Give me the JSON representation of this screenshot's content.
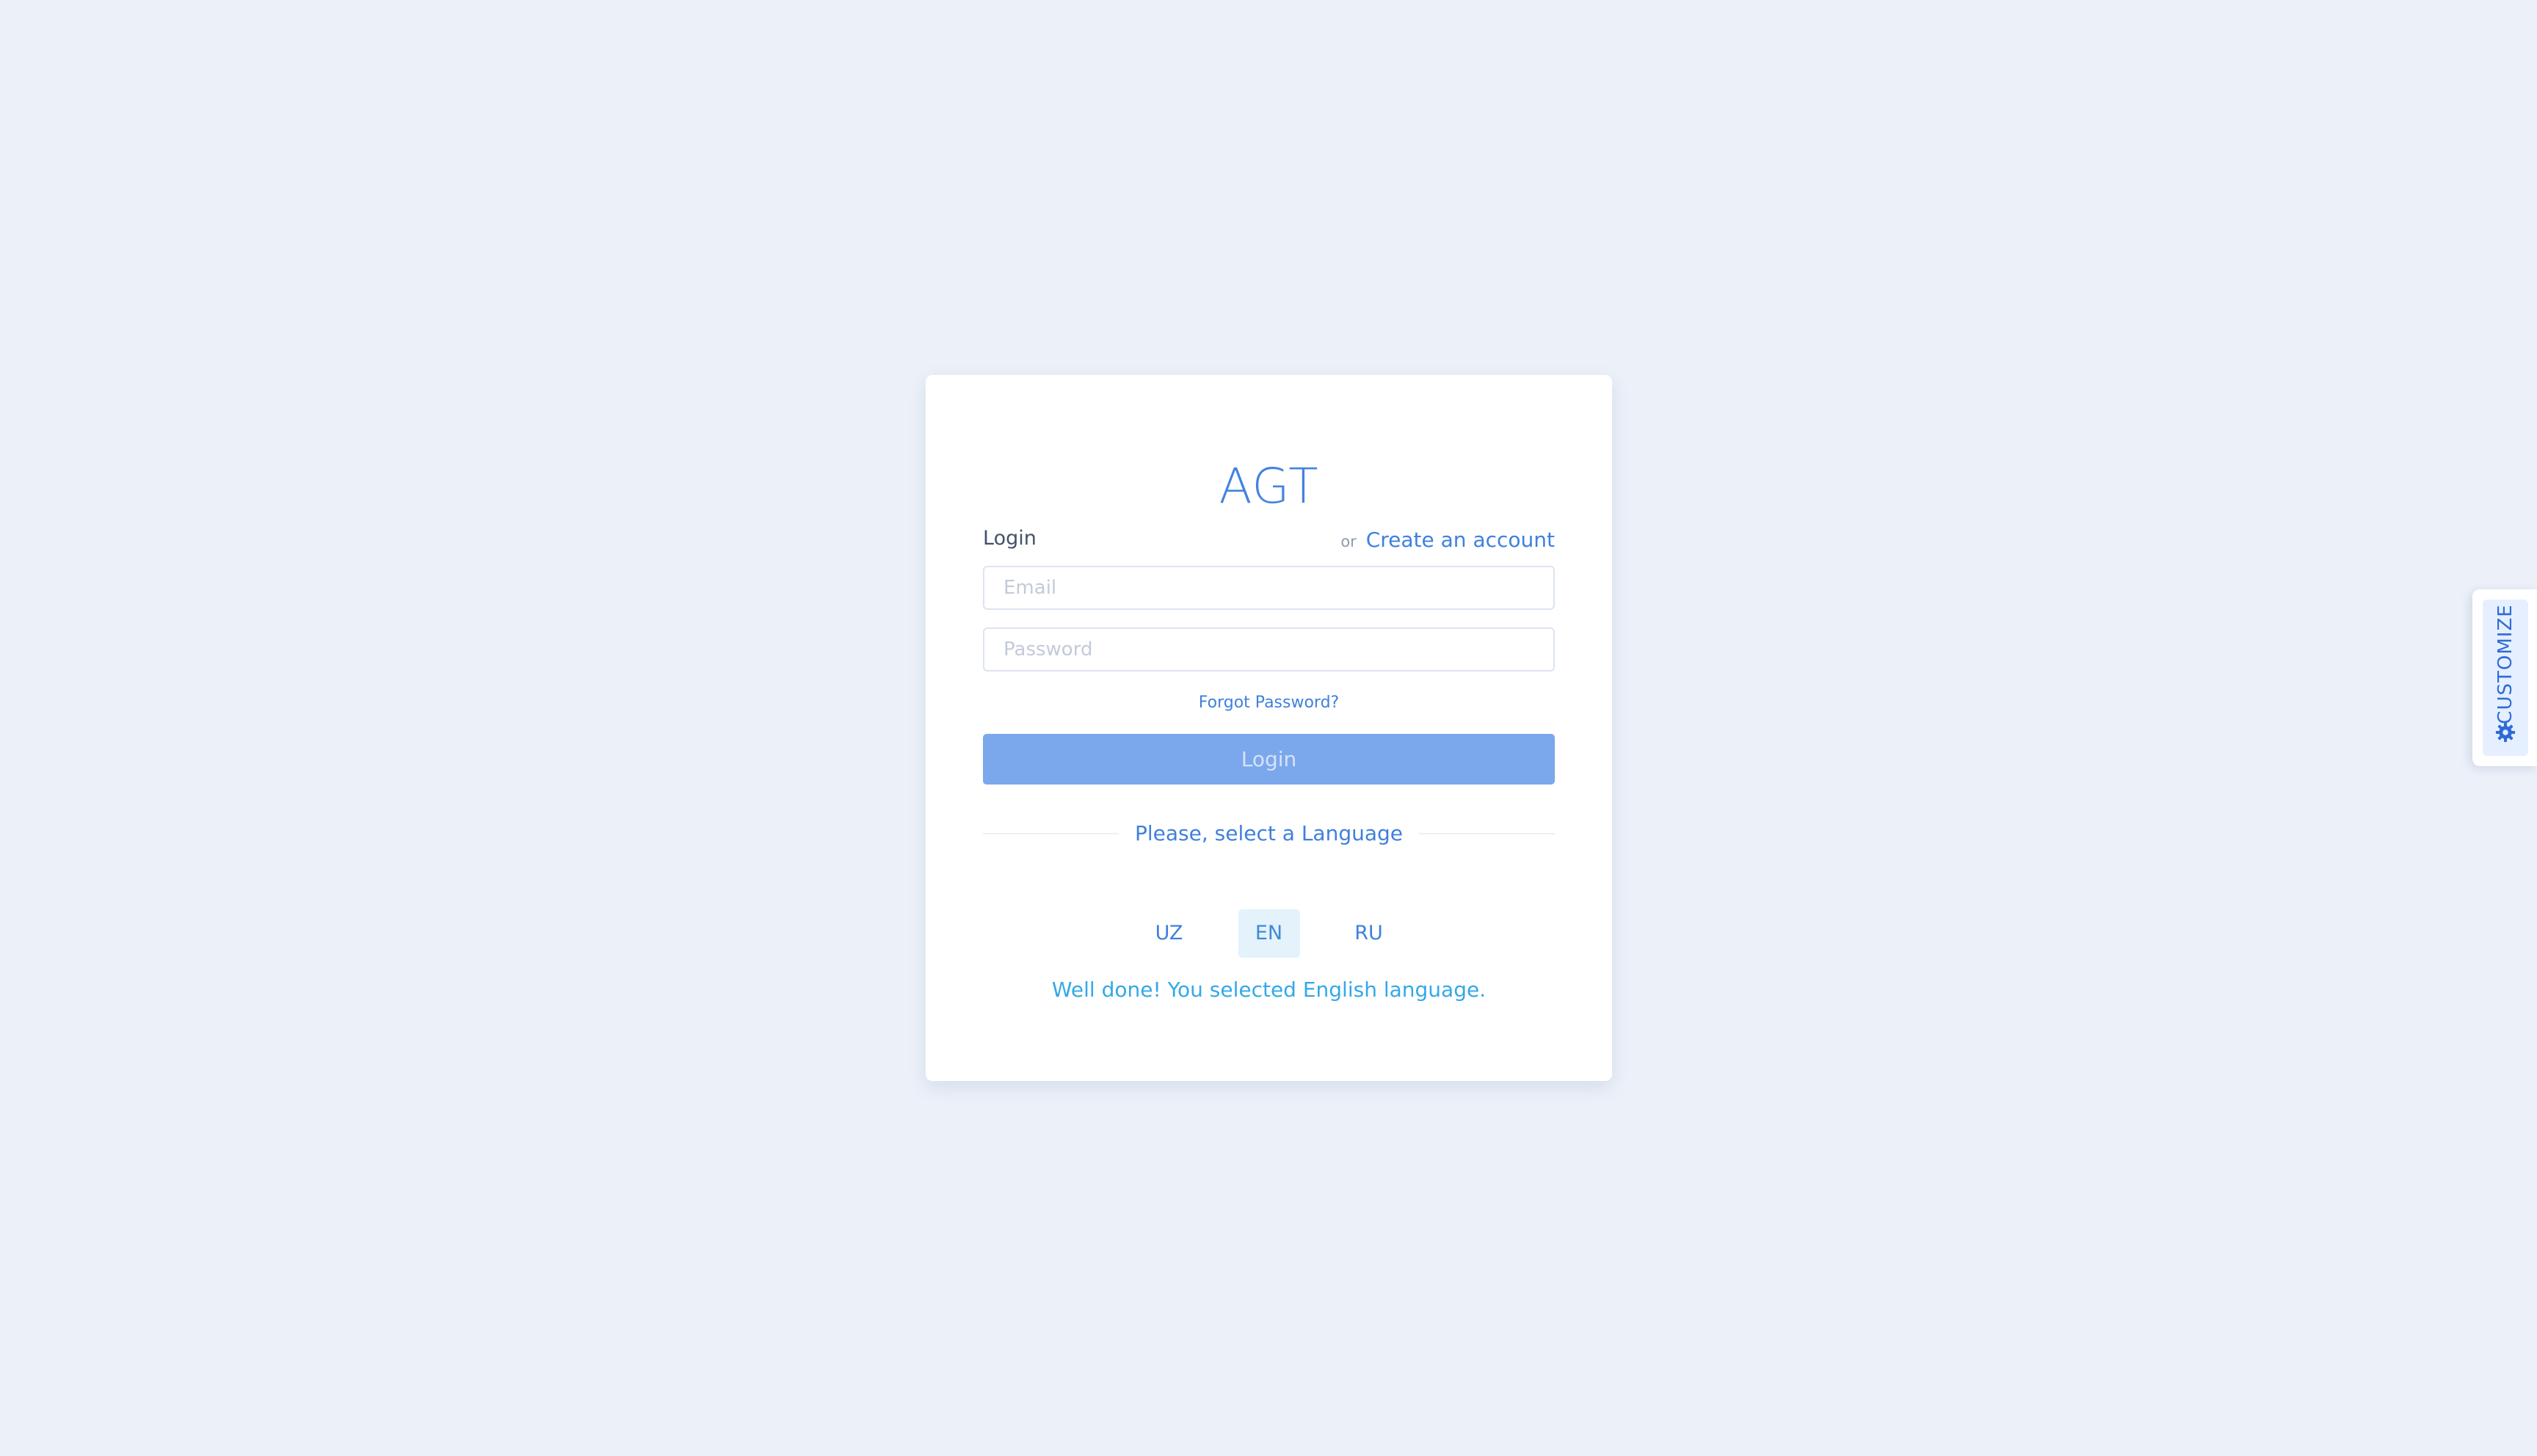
{
  "brand": {
    "title": "AGT"
  },
  "login": {
    "label": "Login",
    "or_text": "or",
    "create_account_label": "Create an account",
    "email_placeholder": "Email",
    "email_value": "",
    "password_placeholder": "Password",
    "password_value": "",
    "forgot_label": "Forgot Password?",
    "submit_label": "Login"
  },
  "language": {
    "prompt": "Please, select a Language",
    "options": [
      "UZ",
      "EN",
      "RU"
    ],
    "selected": "EN",
    "success_message": "Well done! You selected English language."
  },
  "customize": {
    "label": "CUSTOMIZE",
    "icon": "gear-icon"
  },
  "colors": {
    "page_background": "#ecf1f9",
    "accent": "#3f80dd",
    "button": "#7ba7ec",
    "success": "#34a8e8",
    "active_language_bg": "#e3f2fb"
  }
}
